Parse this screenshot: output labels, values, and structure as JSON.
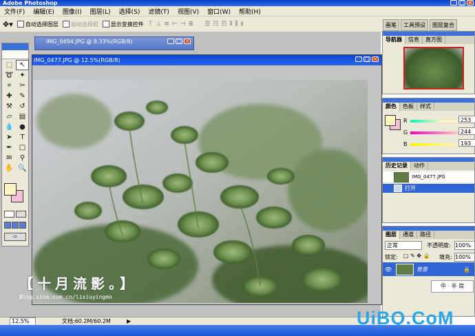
{
  "app": {
    "title": "Adobe Photoshop"
  },
  "menu": [
    "文件(F)",
    "编辑(E)",
    "图像(I)",
    "图层(L)",
    "选择(S)",
    "滤镜(T)",
    "视图(V)",
    "窗口(W)",
    "帮助(H)"
  ],
  "options": {
    "auto_select_layer": "自动选择图层",
    "auto_select_group": "自动选择组",
    "show_transform": "显示变换控件"
  },
  "docs": {
    "back_title": "IMG_0494.JPG @ 8.33%(RGB/8)",
    "front_title": "IMG_0477.JPG @ 12.5%(RGB/8)"
  },
  "status": {
    "zoom": "12.5%",
    "doc_size": "文档:60.2M/60.2M"
  },
  "watermark": {
    "line1": "【十月流影。】",
    "line2": "Blog.sina.com.cn/lixiuyingmn"
  },
  "brand": "UiBQ.CoM",
  "right_tabs": [
    "画笔",
    "工具预设",
    "图层复合"
  ],
  "navigator": {
    "tabs": [
      "导航器",
      "信息",
      "直方图"
    ]
  },
  "color_panel": {
    "tabs": [
      "颜色",
      "色板",
      "样式"
    ],
    "r_label": "R",
    "g_label": "G",
    "b_label": "B",
    "r": "253",
    "g": "244",
    "b": "193",
    "fg_color": "#fdf4c1",
    "bg_color": "#f5c0d6"
  },
  "history": {
    "tabs": [
      "历史记录",
      "动作"
    ],
    "snapshot": "IMG_0477.JPG",
    "items": [
      "打开"
    ]
  },
  "layers": {
    "tabs": [
      "图层",
      "通道",
      "路径"
    ],
    "blend_mode": "正常",
    "opacity_label": "不透明度:",
    "opacity": "100%",
    "lock_label": "锁定:",
    "fill_label": "填充:",
    "fill": "100%",
    "layer_name": "背景"
  },
  "ime": "中 · 半 简"
}
